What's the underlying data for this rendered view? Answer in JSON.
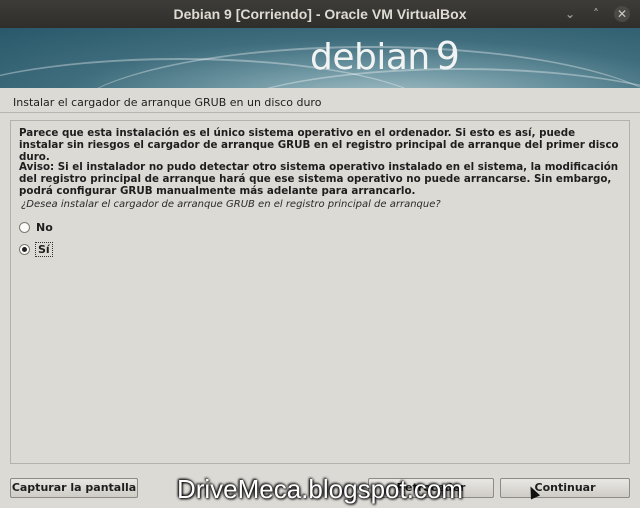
{
  "window": {
    "title": "Debian 9 [Corriendo] - Oracle VM VirtualBox",
    "minimize_glyph": "⌄",
    "maximize_glyph": "˄",
    "close_glyph": "✕"
  },
  "banner": {
    "logo_text": "debian",
    "logo_version": "9"
  },
  "step_heading": "Instalar el cargador de arranque GRUB en un disco duro",
  "content": {
    "paragraph1": "Parece que esta instalación es el único sistema operativo en el ordenador. Si esto es así, puede instalar sin riesgos el cargador de arranque GRUB en el registro principal de arranque del primer disco duro.",
    "paragraph2": "Aviso: Si el instalador no pudo detectar otro sistema operativo instalado en el sistema, la modificación del registro principal de arranque hará que ese sistema operativo no puede arrancarse. Sin embargo, podrá configurar GRUB manualmente más adelante para arrancarlo.",
    "question": "¿Desea instalar el cargador de arranque GRUB en el registro principal de arranque?",
    "options": [
      {
        "label": "No",
        "selected": false
      },
      {
        "label": "Sí",
        "selected": true
      }
    ]
  },
  "buttons": {
    "capture": "Capturar la pantalla",
    "back": "Retroceder",
    "continue": "Continuar"
  },
  "watermark": "DriveMeca.blogspot.com"
}
